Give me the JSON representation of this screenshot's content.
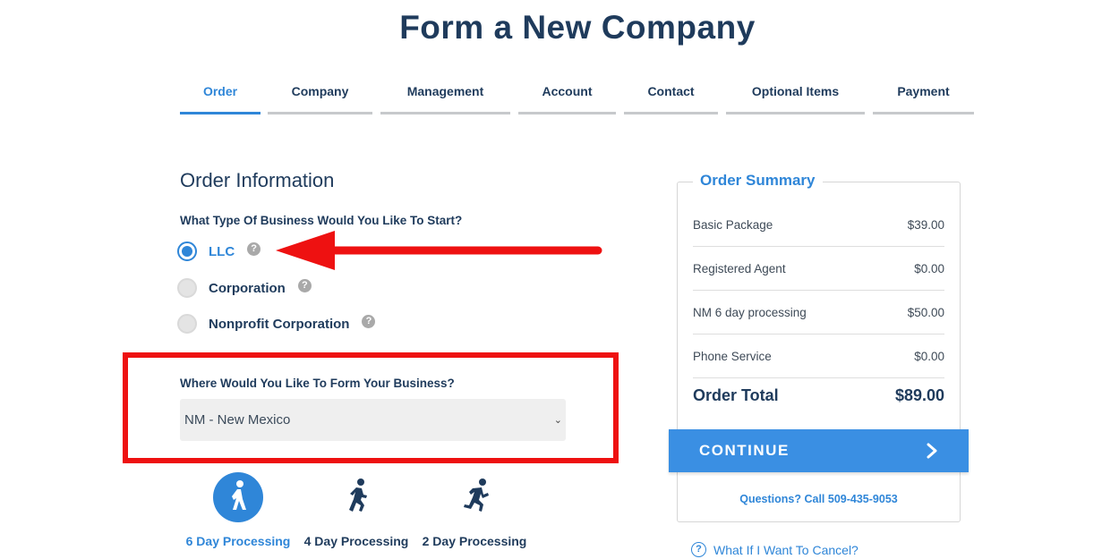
{
  "page": {
    "title": "Form a New Company"
  },
  "tabs": [
    {
      "label": "Order",
      "active": true
    },
    {
      "label": "Company"
    },
    {
      "label": "Management"
    },
    {
      "label": "Account"
    },
    {
      "label": "Contact"
    },
    {
      "label": "Optional Items"
    },
    {
      "label": "Payment"
    }
  ],
  "order_info": {
    "title": "Order Information",
    "business_type_question": "What Type Of Business Would You Like To Start?",
    "business_types": [
      {
        "label": "LLC",
        "selected": true
      },
      {
        "label": "Corporation",
        "selected": false
      },
      {
        "label": "Nonprofit Corporation",
        "selected": false
      }
    ],
    "help_glyph": "?",
    "state_question": "Where Would You Like To Form Your Business?",
    "state_selected": "NM - New Mexico",
    "processing_options": [
      {
        "label": "6 Day Processing",
        "icon": "walking-person-icon",
        "selected": true
      },
      {
        "label": "4 Day Processing",
        "icon": "jogging-person-icon",
        "selected": false
      },
      {
        "label": "2 Day Processing",
        "icon": "running-person-icon",
        "selected": false
      }
    ]
  },
  "summary": {
    "title": "Order Summary",
    "items": [
      {
        "label": "Basic Package",
        "price": "$39.00"
      },
      {
        "label": "Registered Agent",
        "price": "$0.00"
      },
      {
        "label": "NM 6 day processing",
        "price": "$50.00"
      },
      {
        "label": "Phone Service",
        "price": "$0.00"
      }
    ],
    "total_label": "Order Total",
    "total_value": "$89.00",
    "continue_label": "CONTINUE",
    "phone_text": "Questions? Call 509-435-9053",
    "cancel_text": "What If I Want To Cancel?"
  },
  "colors": {
    "accent": "#2f86d8",
    "heading": "#1f3b5c",
    "annotation_red": "#ee1111"
  }
}
